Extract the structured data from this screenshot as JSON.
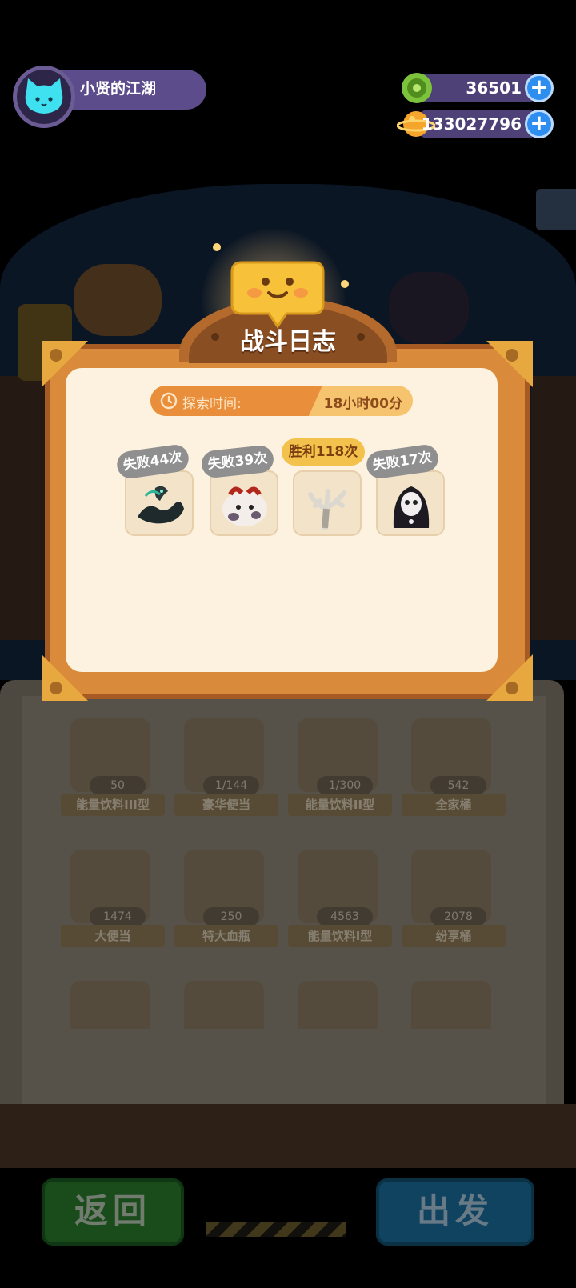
{
  "player": {
    "name": "小贤的江湖",
    "avatar_icon": "cat-avatar-icon"
  },
  "currencies": [
    {
      "icon": "green-gem-icon",
      "value": "36501",
      "plus_label": "+"
    },
    {
      "icon": "gold-planet-coin-icon",
      "value": "133027796",
      "plus_label": "+"
    }
  ],
  "dialog": {
    "title": "战斗日志",
    "time_label": "探索时间:",
    "time_value": "18小时00分钟",
    "enemies": [
      {
        "result": "失败44次",
        "outcome": "fail",
        "icon": "dragon-icon"
      },
      {
        "result": "失败39次",
        "outcome": "fail",
        "icon": "cow-demon-icon"
      },
      {
        "result": "胜利118次",
        "outcome": "win",
        "icon": "dead-tree-icon"
      },
      {
        "result": "失败17次",
        "outcome": "fail",
        "icon": "ghost-reaper-icon"
      }
    ]
  },
  "inventory": [
    {
      "name": "能量饮料III型",
      "count": "50"
    },
    {
      "name": "豪华便当",
      "count": "1/144"
    },
    {
      "name": "能量饮料II型",
      "count": "1/300"
    },
    {
      "name": "全家桶",
      "count": "542"
    },
    {
      "name": "大便当",
      "count": "1474"
    },
    {
      "name": "特大血瓶",
      "count": "250"
    },
    {
      "name": "能量饮料I型",
      "count": "4563"
    },
    {
      "name": "纷享桶",
      "count": "2078"
    }
  ],
  "buttons": {
    "back": "返回",
    "go": "出发"
  },
  "colors": {
    "dialog_frame": "#d98a3a",
    "fail_tag": "#8f8f8f",
    "win_tag": "#f3c24d",
    "plus_button": "#2e8ef0"
  }
}
